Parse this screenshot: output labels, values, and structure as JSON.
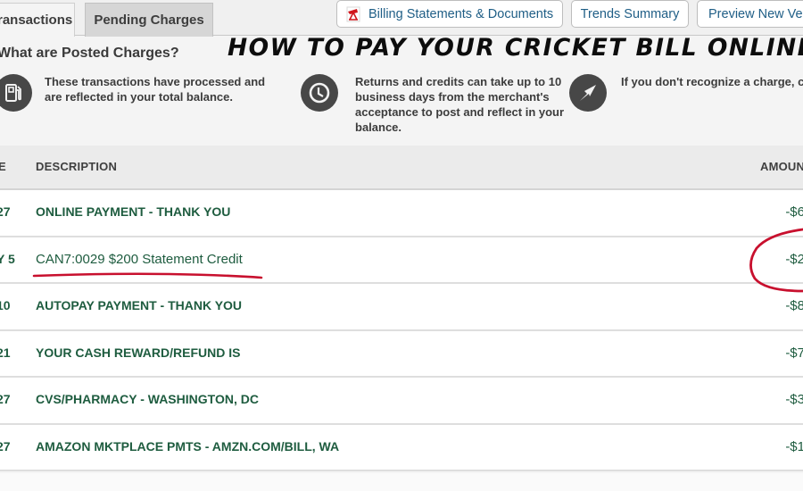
{
  "overlay": {
    "headline": "HOW TO PAY YOUR CRICKET BILL ONLINE?"
  },
  "tabs": [
    {
      "label": "ransactions",
      "active": true
    },
    {
      "label": "Pending Charges",
      "active": false
    }
  ],
  "toolbar": {
    "billing_label": "Billing Statements & Documents",
    "trends_label": "Trends Summary",
    "preview_label": "Preview New Ver"
  },
  "info": {
    "title": "What are Posted Charges?",
    "items": [
      {
        "icon": "fuel-pump-icon",
        "text": "These transactions have processed and are reflected in your total balance."
      },
      {
        "icon": "clock-icon",
        "text": "Returns and credits can take up to 10 business days from the merchant's acceptance to post and reflect in your balance."
      },
      {
        "icon": "compass-arrow-icon",
        "text": "If you don't recognize a charge, cli on the transaction to expand for th details."
      }
    ]
  },
  "table": {
    "headers": {
      "date": "E",
      "description": "DESCRIPTION",
      "amount": "AMOUN"
    },
    "rows": [
      {
        "date": "27",
        "description": "ONLINE PAYMENT - THANK YOU",
        "amount": "-$6"
      },
      {
        "date": "Y 5",
        "description": "CAN7:0029 $200 Statement Credit",
        "amount": "-$2",
        "highlighted": true
      },
      {
        "date": "10",
        "description": "AUTOPAY PAYMENT - THANK YOU",
        "amount": "-$8"
      },
      {
        "date": "21",
        "description": "YOUR CASH REWARD/REFUND IS",
        "amount": "-$7"
      },
      {
        "date": "27",
        "description": "CVS/PHARMACY - WASHINGTON, DC",
        "amount": "-$3"
      },
      {
        "date": "27",
        "description": "AMAZON MKTPLACE PMTS - AMZN.COM/BILL, WA",
        "amount": "-$1"
      }
    ]
  },
  "colors": {
    "link_blue": "#1f5e86",
    "row_green": "#1e5c3f",
    "annotation_red": "#c8102e",
    "icon_dark": "#474747"
  }
}
